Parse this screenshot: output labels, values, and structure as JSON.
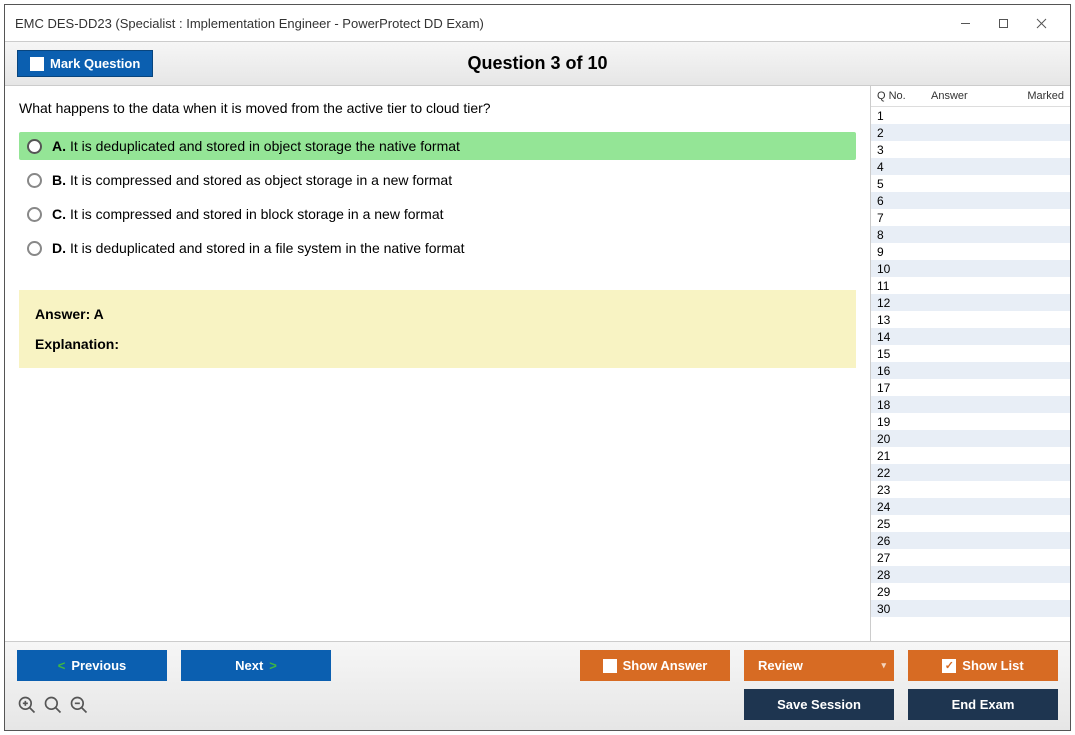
{
  "window": {
    "title": "EMC DES-DD23 (Specialist : Implementation Engineer - PowerProtect DD Exam)"
  },
  "header": {
    "mark_label": "Mark Question",
    "question_title": "Question 3 of 10"
  },
  "question": {
    "text": "What happens to the data when it is moved from the active tier to cloud tier?",
    "options": [
      {
        "letter": "A.",
        "text": "It is deduplicated and stored in object storage the native format",
        "selected": true
      },
      {
        "letter": "B.",
        "text": "It is compressed and stored as object storage in a new format",
        "selected": false
      },
      {
        "letter": "C.",
        "text": "It is compressed and stored in block storage in a new format",
        "selected": false
      },
      {
        "letter": "D.",
        "text": "It is deduplicated and stored in a file system in the native format",
        "selected": false
      }
    ],
    "answer_label": "Answer: A",
    "explanation_label": "Explanation:"
  },
  "sidebar": {
    "headers": {
      "qno": "Q No.",
      "answer": "Answer",
      "marked": "Marked"
    },
    "rows": [
      {
        "n": "1"
      },
      {
        "n": "2"
      },
      {
        "n": "3"
      },
      {
        "n": "4"
      },
      {
        "n": "5"
      },
      {
        "n": "6"
      },
      {
        "n": "7"
      },
      {
        "n": "8"
      },
      {
        "n": "9"
      },
      {
        "n": "10"
      },
      {
        "n": "11"
      },
      {
        "n": "12"
      },
      {
        "n": "13"
      },
      {
        "n": "14"
      },
      {
        "n": "15"
      },
      {
        "n": "16"
      },
      {
        "n": "17"
      },
      {
        "n": "18"
      },
      {
        "n": "19"
      },
      {
        "n": "20"
      },
      {
        "n": "21"
      },
      {
        "n": "22"
      },
      {
        "n": "23"
      },
      {
        "n": "24"
      },
      {
        "n": "25"
      },
      {
        "n": "26"
      },
      {
        "n": "27"
      },
      {
        "n": "28"
      },
      {
        "n": "29"
      },
      {
        "n": "30"
      }
    ]
  },
  "footer": {
    "previous": "Previous",
    "next": "Next",
    "show_answer": "Show Answer",
    "review": "Review",
    "show_list": "Show List",
    "save_session": "Save Session",
    "end_exam": "End Exam"
  }
}
